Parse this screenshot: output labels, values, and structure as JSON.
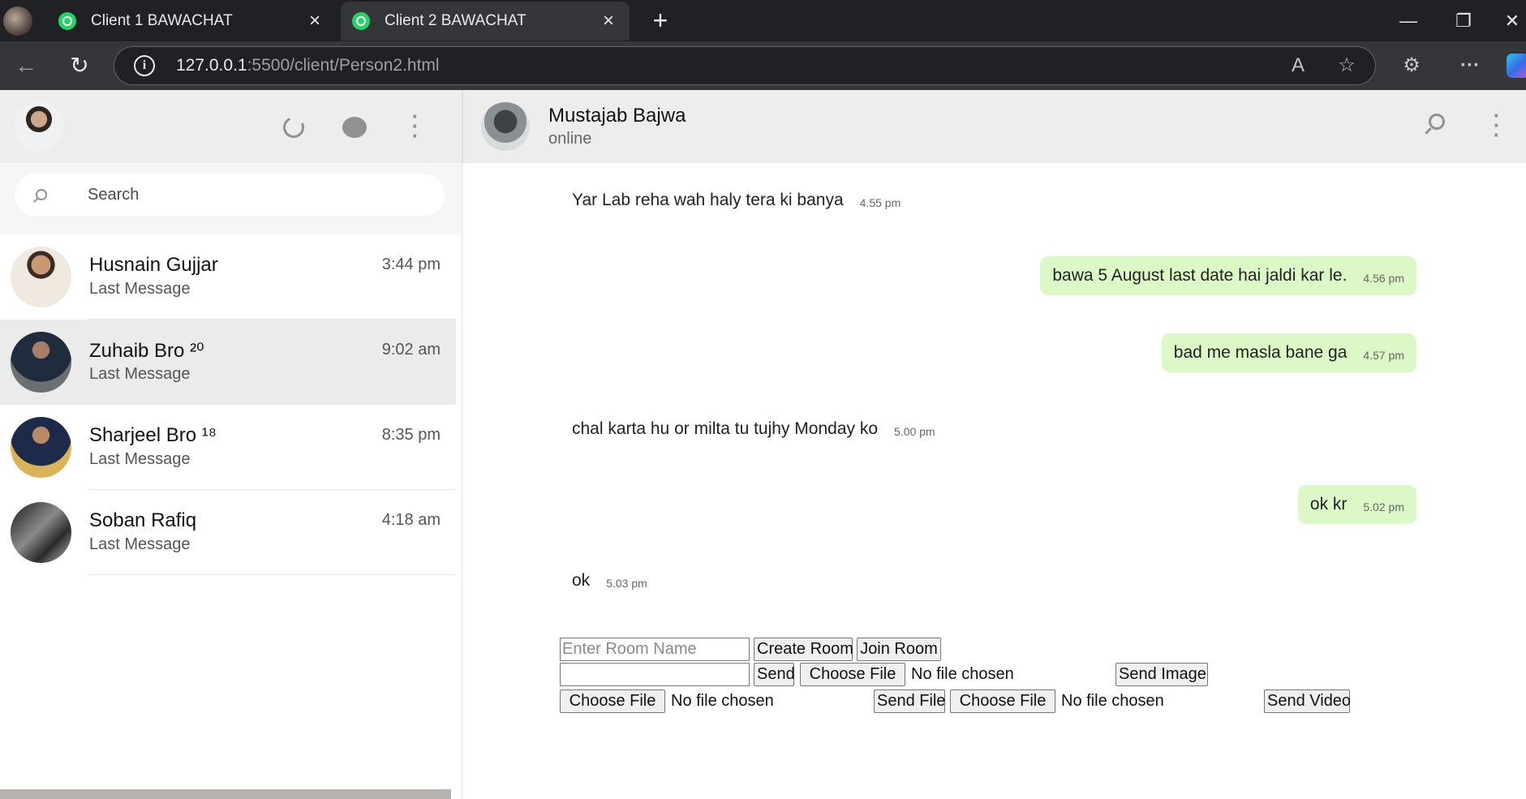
{
  "browser": {
    "tabs": [
      {
        "title": "Client 1 BAWACHAT",
        "active": false
      },
      {
        "title": "Client 2 BAWACHAT",
        "active": true
      }
    ],
    "url_host": "127.0.0.1",
    "url_rest": ":5500/client/Person2.html",
    "icons": [
      "profile-avatar",
      "whatsapp-icon",
      "close-icon",
      "new-tab-icon",
      "minimize-icon",
      "restore-icon",
      "close-window-icon",
      "back-icon",
      "reload-icon",
      "site-info-icon",
      "read-aloud-icon",
      "favorite-star-icon",
      "extensions-icon",
      "more-icon",
      "copilot-icon"
    ]
  },
  "sidebar": {
    "search_placeholder": "Search",
    "contacts": [
      {
        "name": "Husnain Gujjar",
        "last": "Last Message",
        "time": "3:44 pm",
        "selected": false
      },
      {
        "name": "Zuhaib Bro ²⁰",
        "last": "Last Message",
        "time": "9:02 am",
        "selected": true
      },
      {
        "name": "Sharjeel Bro ¹⁸",
        "last": "Last Message",
        "time": "8:35 pm",
        "selected": false
      },
      {
        "name": "Soban Rafiq",
        "last": "Last Message",
        "time": "4:18 am",
        "selected": false
      }
    ]
  },
  "chat": {
    "peer_name": "Mustajab Bajwa",
    "peer_status": "online",
    "messages": [
      {
        "text": "Yar Lab reha wah haly tera ki banya",
        "time": "4.55 pm",
        "dir": "in"
      },
      {
        "text": "bawa 5 August last date hai jaldi kar le.",
        "time": "4.56 pm",
        "dir": "out"
      },
      {
        "text": "bad me masla bane ga",
        "time": "4.57 pm",
        "dir": "out"
      },
      {
        "text": "chal karta hu or milta tu tujhy Monday ko",
        "time": "5.00 pm",
        "dir": "in"
      },
      {
        "text": "ok kr",
        "time": "5.02 pm",
        "dir": "out"
      },
      {
        "text": "ok",
        "time": "5.03 pm",
        "dir": "in"
      }
    ]
  },
  "controls": {
    "room_placeholder": "Enter Room Name",
    "create_room": "Create Room",
    "join_room": "Join Room",
    "send": "Send",
    "choose_file": "Choose File",
    "no_file": "No file chosen",
    "send_image": "Send Image",
    "send_file": "Send File",
    "send_video": "Send Video"
  },
  "colors": {
    "outgoing_bubble": "#dcf8c6",
    "header_bg": "#ededed",
    "whatsapp_green": "#25d366"
  }
}
